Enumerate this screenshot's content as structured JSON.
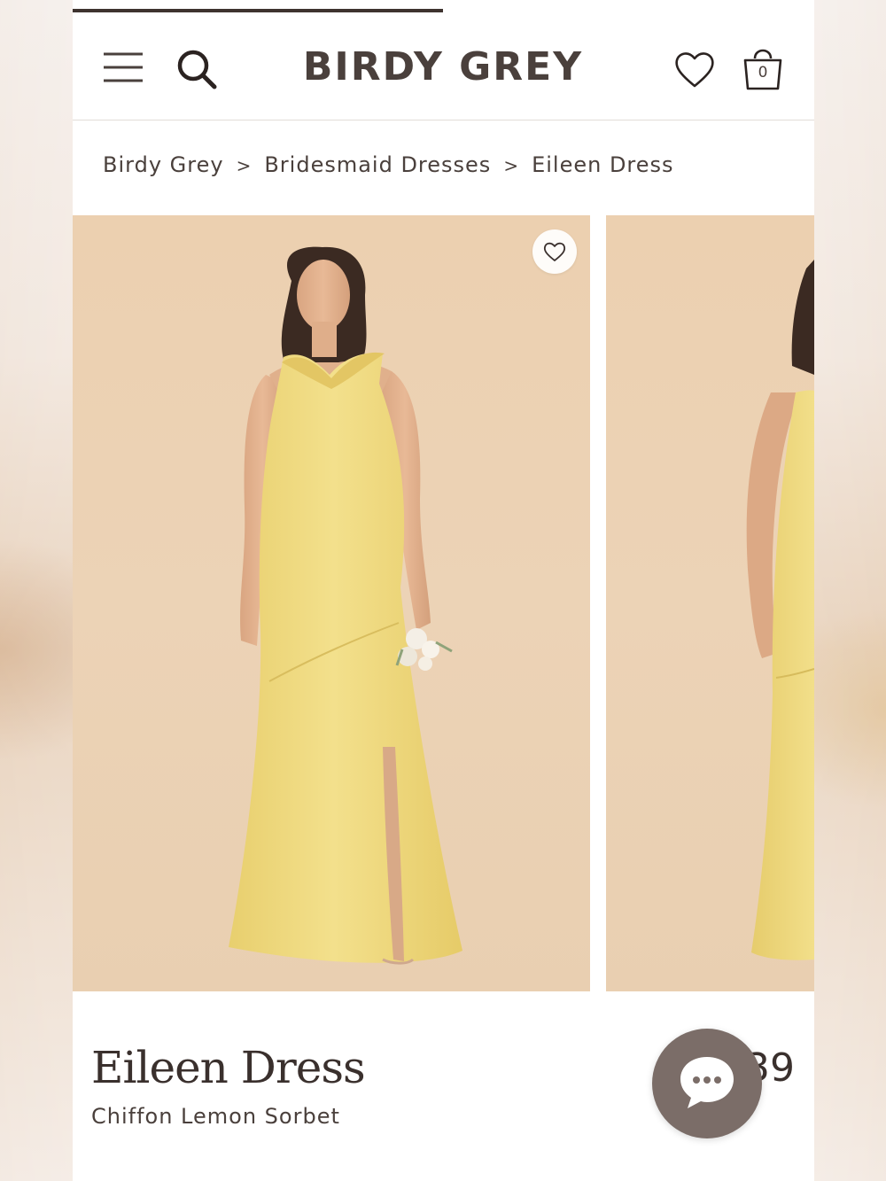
{
  "header": {
    "logo": "BIRDY GREY",
    "menu_icon": "hamburger-menu-icon",
    "search_icon": "search-icon",
    "wishlist_icon": "heart-icon",
    "bag_icon": "shopping-bag-icon",
    "bag_count": "0"
  },
  "breadcrumb": {
    "items": [
      "Birdy Grey",
      "Bridesmaid Dresses",
      "Eileen Dress"
    ],
    "separator": ">"
  },
  "gallery": {
    "favorite_icon": "heart-icon",
    "dress_color": "#f0dd82",
    "background_color": "#ecd1b3"
  },
  "product": {
    "title": "Eileen Dress",
    "subtitle": "Chiffon Lemon Sorbet",
    "price_visible": "39"
  },
  "chat": {
    "icon": "chat-bubble-icon",
    "color": "#7b6d68"
  }
}
